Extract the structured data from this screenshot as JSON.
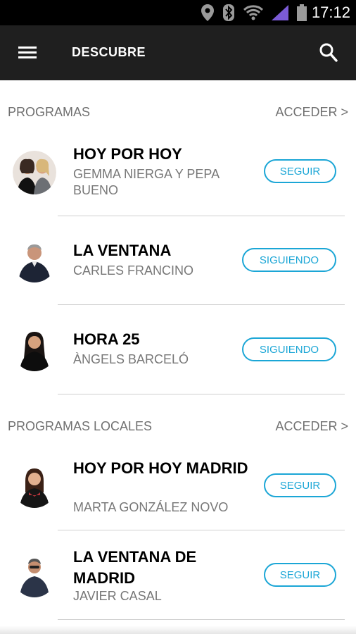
{
  "statusbar": {
    "time": "17:12"
  },
  "appbar": {
    "title": "DESCUBRE"
  },
  "sections": [
    {
      "title": "PROGRAMAS",
      "link": "ACCEDER >",
      "items": [
        {
          "title": "HOY POR HOY",
          "subtitle": "GEMMA NIERGA Y PEPA BUENO",
          "button": "SEGUIR"
        },
        {
          "title": "LA VENTANA",
          "subtitle": "CARLES FRANCINO",
          "button": "SIGUIENDO"
        },
        {
          "title": "HORA 25",
          "subtitle": "ÀNGELS BARCELÓ",
          "button": "SIGUIENDO"
        }
      ]
    },
    {
      "title": "PROGRAMAS LOCALES",
      "link": "ACCEDER >",
      "items": [
        {
          "title": "HOY POR HOY MADRID",
          "subtitle": "MARTA GONZÁLEZ NOVO",
          "button": "SEGUIR"
        },
        {
          "title": "LA VENTANA DE MADRID",
          "subtitle": "JAVIER CASAL",
          "button": "SEGUIR"
        }
      ]
    }
  ],
  "colors": {
    "accent": "#1ba6d6",
    "appbar": "#1f1f1f"
  },
  "icons": [
    "location-icon",
    "bluetooth-icon",
    "wifi-icon",
    "signal-icon",
    "battery-icon",
    "menu-icon",
    "search-icon"
  ]
}
